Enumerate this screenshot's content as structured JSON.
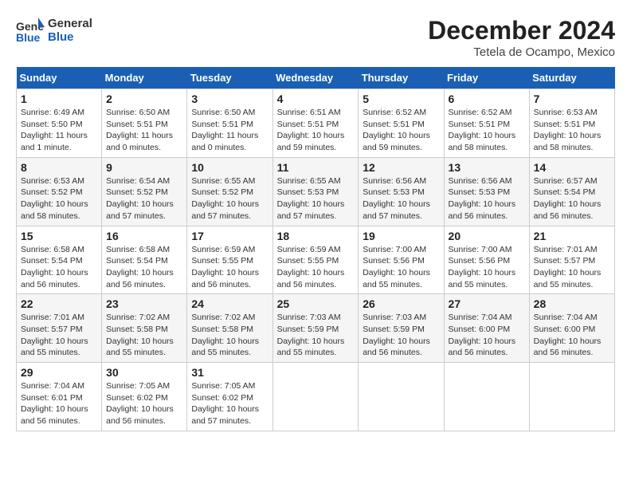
{
  "header": {
    "logo_line1": "General",
    "logo_line2": "Blue",
    "month": "December 2024",
    "location": "Tetela de Ocampo, Mexico"
  },
  "weekdays": [
    "Sunday",
    "Monday",
    "Tuesday",
    "Wednesday",
    "Thursday",
    "Friday",
    "Saturday"
  ],
  "weeks": [
    [
      {
        "day": "1",
        "info": "Sunrise: 6:49 AM\nSunset: 5:50 PM\nDaylight: 11 hours and 1 minute."
      },
      {
        "day": "2",
        "info": "Sunrise: 6:50 AM\nSunset: 5:51 PM\nDaylight: 11 hours and 0 minutes."
      },
      {
        "day": "3",
        "info": "Sunrise: 6:50 AM\nSunset: 5:51 PM\nDaylight: 11 hours and 0 minutes."
      },
      {
        "day": "4",
        "info": "Sunrise: 6:51 AM\nSunset: 5:51 PM\nDaylight: 10 hours and 59 minutes."
      },
      {
        "day": "5",
        "info": "Sunrise: 6:52 AM\nSunset: 5:51 PM\nDaylight: 10 hours and 59 minutes."
      },
      {
        "day": "6",
        "info": "Sunrise: 6:52 AM\nSunset: 5:51 PM\nDaylight: 10 hours and 58 minutes."
      },
      {
        "day": "7",
        "info": "Sunrise: 6:53 AM\nSunset: 5:51 PM\nDaylight: 10 hours and 58 minutes."
      }
    ],
    [
      {
        "day": "8",
        "info": "Sunrise: 6:53 AM\nSunset: 5:52 PM\nDaylight: 10 hours and 58 minutes."
      },
      {
        "day": "9",
        "info": "Sunrise: 6:54 AM\nSunset: 5:52 PM\nDaylight: 10 hours and 57 minutes."
      },
      {
        "day": "10",
        "info": "Sunrise: 6:55 AM\nSunset: 5:52 PM\nDaylight: 10 hours and 57 minutes."
      },
      {
        "day": "11",
        "info": "Sunrise: 6:55 AM\nSunset: 5:53 PM\nDaylight: 10 hours and 57 minutes."
      },
      {
        "day": "12",
        "info": "Sunrise: 6:56 AM\nSunset: 5:53 PM\nDaylight: 10 hours and 57 minutes."
      },
      {
        "day": "13",
        "info": "Sunrise: 6:56 AM\nSunset: 5:53 PM\nDaylight: 10 hours and 56 minutes."
      },
      {
        "day": "14",
        "info": "Sunrise: 6:57 AM\nSunset: 5:54 PM\nDaylight: 10 hours and 56 minutes."
      }
    ],
    [
      {
        "day": "15",
        "info": "Sunrise: 6:58 AM\nSunset: 5:54 PM\nDaylight: 10 hours and 56 minutes."
      },
      {
        "day": "16",
        "info": "Sunrise: 6:58 AM\nSunset: 5:54 PM\nDaylight: 10 hours and 56 minutes."
      },
      {
        "day": "17",
        "info": "Sunrise: 6:59 AM\nSunset: 5:55 PM\nDaylight: 10 hours and 56 minutes."
      },
      {
        "day": "18",
        "info": "Sunrise: 6:59 AM\nSunset: 5:55 PM\nDaylight: 10 hours and 56 minutes."
      },
      {
        "day": "19",
        "info": "Sunrise: 7:00 AM\nSunset: 5:56 PM\nDaylight: 10 hours and 55 minutes."
      },
      {
        "day": "20",
        "info": "Sunrise: 7:00 AM\nSunset: 5:56 PM\nDaylight: 10 hours and 55 minutes."
      },
      {
        "day": "21",
        "info": "Sunrise: 7:01 AM\nSunset: 5:57 PM\nDaylight: 10 hours and 55 minutes."
      }
    ],
    [
      {
        "day": "22",
        "info": "Sunrise: 7:01 AM\nSunset: 5:57 PM\nDaylight: 10 hours and 55 minutes."
      },
      {
        "day": "23",
        "info": "Sunrise: 7:02 AM\nSunset: 5:58 PM\nDaylight: 10 hours and 55 minutes."
      },
      {
        "day": "24",
        "info": "Sunrise: 7:02 AM\nSunset: 5:58 PM\nDaylight: 10 hours and 55 minutes."
      },
      {
        "day": "25",
        "info": "Sunrise: 7:03 AM\nSunset: 5:59 PM\nDaylight: 10 hours and 55 minutes."
      },
      {
        "day": "26",
        "info": "Sunrise: 7:03 AM\nSunset: 5:59 PM\nDaylight: 10 hours and 56 minutes."
      },
      {
        "day": "27",
        "info": "Sunrise: 7:04 AM\nSunset: 6:00 PM\nDaylight: 10 hours and 56 minutes."
      },
      {
        "day": "28",
        "info": "Sunrise: 7:04 AM\nSunset: 6:00 PM\nDaylight: 10 hours and 56 minutes."
      }
    ],
    [
      {
        "day": "29",
        "info": "Sunrise: 7:04 AM\nSunset: 6:01 PM\nDaylight: 10 hours and 56 minutes."
      },
      {
        "day": "30",
        "info": "Sunrise: 7:05 AM\nSunset: 6:02 PM\nDaylight: 10 hours and 56 minutes."
      },
      {
        "day": "31",
        "info": "Sunrise: 7:05 AM\nSunset: 6:02 PM\nDaylight: 10 hours and 57 minutes."
      },
      {
        "day": "",
        "info": ""
      },
      {
        "day": "",
        "info": ""
      },
      {
        "day": "",
        "info": ""
      },
      {
        "day": "",
        "info": ""
      }
    ]
  ]
}
